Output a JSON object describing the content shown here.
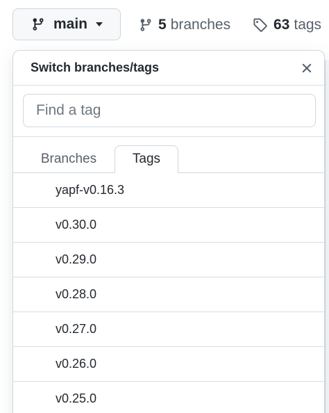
{
  "branch_selector": {
    "label": "main"
  },
  "counters": {
    "branches": {
      "count": "5",
      "label": "branches"
    },
    "tags": {
      "count": "63",
      "label": "tags"
    }
  },
  "dropdown": {
    "title": "Switch branches/tags",
    "filter_placeholder": "Find a tag",
    "tabs": [
      {
        "label": "Branches",
        "selected": false
      },
      {
        "label": "Tags",
        "selected": true
      }
    ],
    "tags": [
      "yapf-v0.16.3",
      "v0.30.0",
      "v0.29.0",
      "v0.28.0",
      "v0.27.0",
      "v0.26.0",
      "v0.25.0"
    ]
  },
  "icons": {
    "branch": "git-branch-icon",
    "tag": "tag-icon",
    "close": "close-icon",
    "caret": "caret-down-icon"
  },
  "colors": {
    "text": "#24292f",
    "muted": "#57606a",
    "border": "#d0d7de"
  }
}
